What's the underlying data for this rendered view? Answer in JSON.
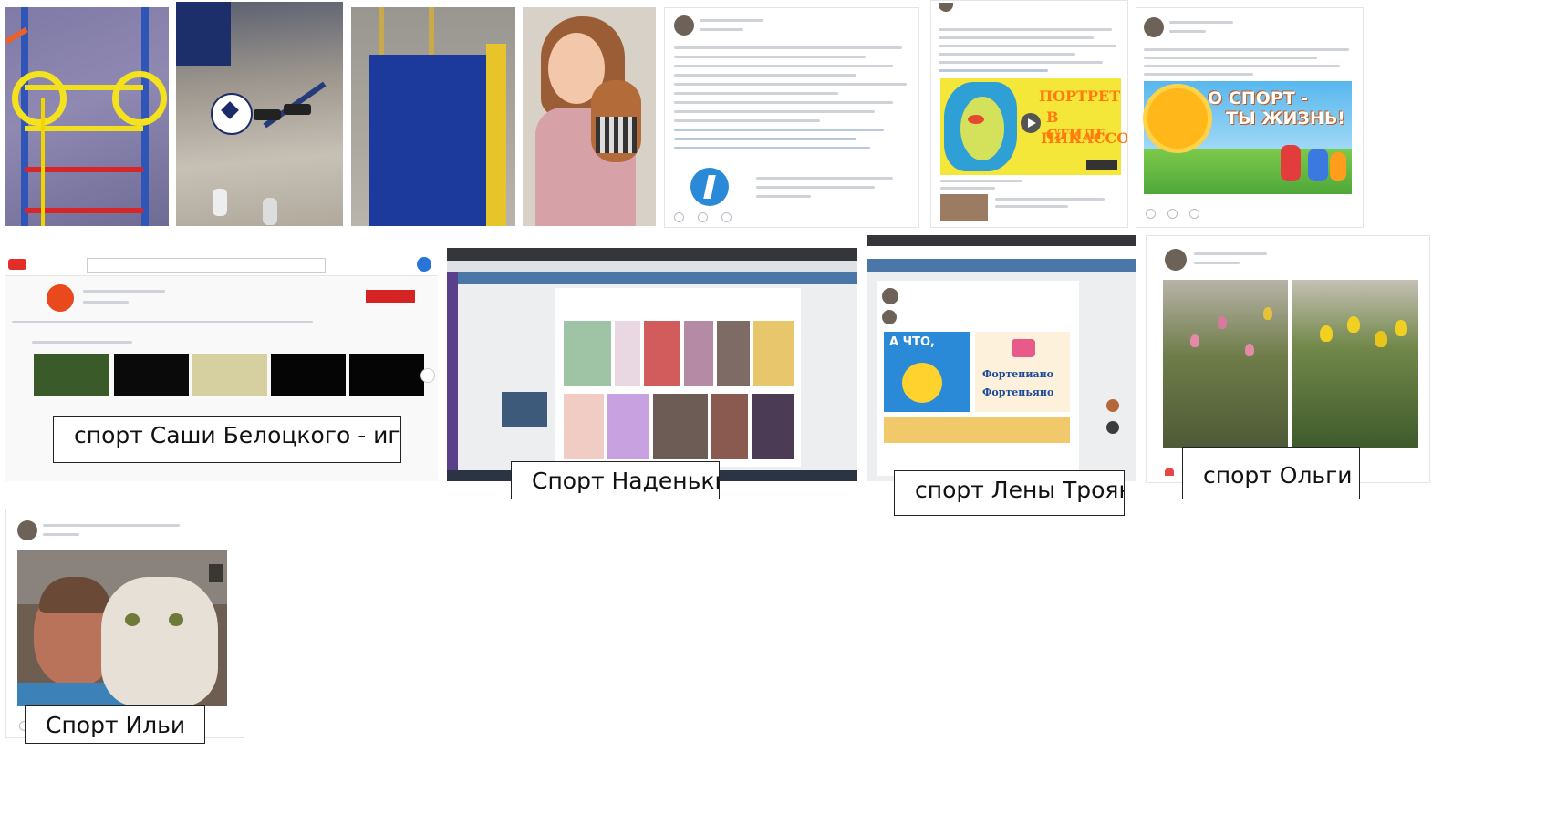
{
  "captions": {
    "sasha": "спорт Саши Белоцкого - игры",
    "nadenka": "Спорт Наденьки",
    "lena": "спорт Лены Троян",
    "olga": "спорт Ольги",
    "ilya": "Спорт Ильи"
  },
  "posters": {
    "picasso_title": [
      "ПОРТРЕТ",
      "В СТИЛЕ",
      "ПИКАССО"
    ],
    "sport_title": [
      "О СПОРТ -",
      "ТЫ ЖИЗНЬ!"
    ],
    "piano_title": [
      "А ЧТО,",
      "Фортепиано",
      "Фортепьяно"
    ]
  },
  "colors": {
    "youtube_red": "#e52d27",
    "vk_blue": "#4a76a8",
    "poster_orange": "#ff7a10",
    "picasso_bg": "#f5e63a"
  }
}
